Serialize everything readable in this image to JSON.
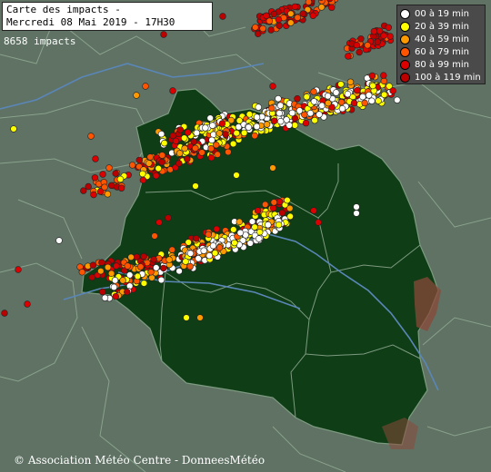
{
  "header": {
    "title_line1": "Carte des impacts -",
    "title_line2": "Mercredi 08 Mai 2019 - 17H30"
  },
  "impacts_count": "8658 impacts",
  "legend": {
    "items": [
      {
        "label": "00 à 19 min",
        "color": "#ffffff"
      },
      {
        "label": "20 à 39 min",
        "color": "#ffff00"
      },
      {
        "label": "40 à 59 min",
        "color": "#ff9900"
      },
      {
        "label": "60 à 79 min",
        "color": "#ff5500"
      },
      {
        "label": "80 à 99 min",
        "color": "#dd0000"
      },
      {
        "label": "100 à 119 min",
        "color": "#bb0000"
      }
    ]
  },
  "credit": "© Association Météo Centre - DonneesMétéo",
  "map": {
    "colors": {
      "background": "#5f7264",
      "region_fill": "#0f3d16",
      "region_border": "#7d9a80",
      "river": "#5a86b8",
      "relief": "#9a5a4a"
    }
  }
}
